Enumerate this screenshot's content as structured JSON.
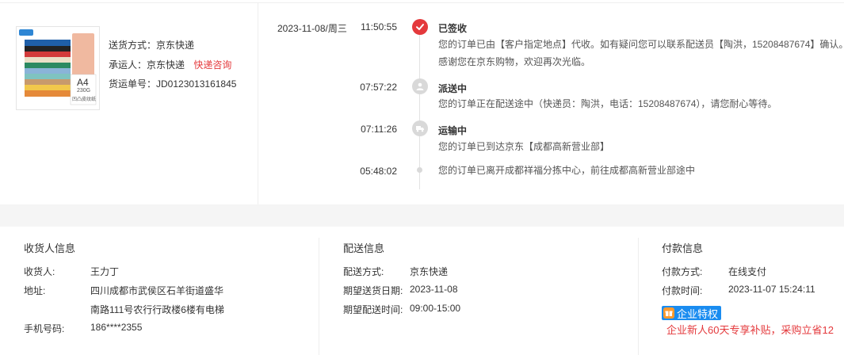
{
  "shipment": {
    "method_label": "送货方式：",
    "method_value": "京东快递",
    "carrier_label": "承运人：",
    "carrier_value": "京东快递",
    "carrier_link": "快递咨询",
    "tracking_label": "货运单号：",
    "tracking_value": "JD0123013161845",
    "product_thumb_text": "A4",
    "product_thumb_sub": "230G",
    "product_thumb_sub2": "凹凸皮纹纸"
  },
  "timeline": {
    "date": "2023-11-08/周三",
    "events": [
      {
        "time": "11:50:55",
        "title": "已签收",
        "lines": [
          "您的订单已由【客户指定地点】代收。如有疑问您可以联系配送员【陶洪，15208487674】确认。",
          "感谢您在京东购物，欢迎再次光临。"
        ],
        "icon": "check-icon"
      },
      {
        "time": "07:57:22",
        "title": "派送中",
        "lines": [
          "您的订单正在配送途中（快递员：陶洪，电话：15208487674），请您耐心等待。"
        ],
        "icon": "delivery-person-icon"
      },
      {
        "time": "07:11:26",
        "title": "运输中",
        "lines": [
          "您的订单已到达京东【成都高新营业部】"
        ],
        "icon": "truck-icon"
      },
      {
        "time": "05:48:02",
        "title": "",
        "lines": [
          "您的订单已离开成都祥福分拣中心，前往成都高新营业部途中"
        ],
        "icon": "dot"
      }
    ]
  },
  "receiver": {
    "section_title": "收货人信息",
    "name_label": "收货人:",
    "name_value": "王力丁",
    "address_label": "地址:",
    "address_line1": "四川成都市武侯区石羊街道盛华",
    "address_line2": "南路111号农行行政楼6楼有电梯",
    "phone_label": "手机号码:",
    "phone_value": "186****2355"
  },
  "delivery": {
    "section_title": "配送信息",
    "method_label": "配送方式:",
    "method_value": "京东快递",
    "date_label": "期望送货日期:",
    "date_value": "2023-11-08",
    "time_label": "期望配送时间:",
    "time_value": "09:00-15:00"
  },
  "payment": {
    "section_title": "付款信息",
    "method_label": "付款方式:",
    "method_value": "在线支付",
    "time_label": "付款时间:",
    "time_value": "2023-11-07 15:24:11",
    "badge_text": "企业特权",
    "promo_text": "企业新人60天专享补贴，采购立省12"
  },
  "colors": {
    "accent_red": "#e4393c",
    "badge_blue": "#1a8cf0",
    "node_gray": "#d9d9d9"
  }
}
